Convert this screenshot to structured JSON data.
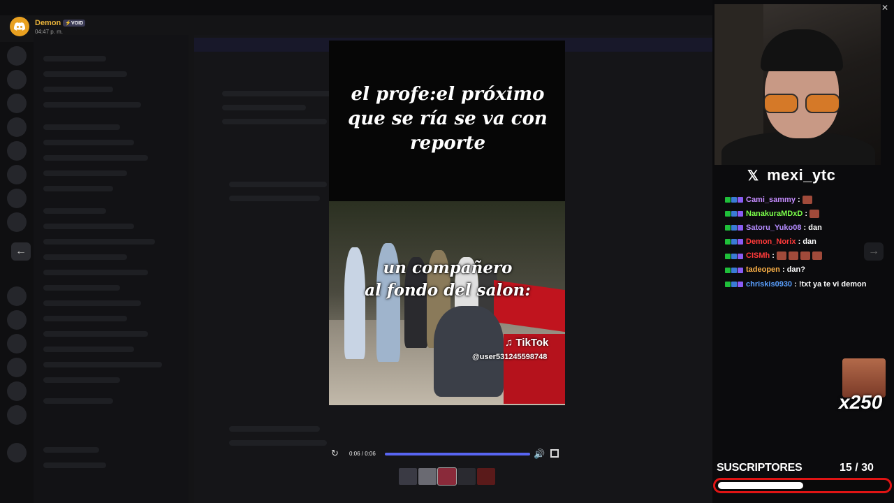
{
  "notification": {
    "icon": "discord-logo-icon",
    "user": "Demon",
    "badge": "⚡VOID",
    "time": "04:47 p. m."
  },
  "video": {
    "caption_top": "el profe:el próximo que se ría se va  con reporte",
    "caption_mid_line1": "un compañero",
    "caption_mid_line2": "al fondo del salon:",
    "watermark_brand": "TikTok",
    "watermark_user": "@user531245598748",
    "time": "0:06 / 0:06",
    "progress": 1.0
  },
  "navigation": {
    "prev_icon": "arrow-left-icon",
    "next_icon": "arrow-right-icon",
    "close_icon": "close-icon"
  },
  "stream": {
    "handle": "mexi_ytc",
    "chat": [
      {
        "user": "Cami_sammy",
        "color": "#c58cff",
        "message": "",
        "emotes": 1
      },
      {
        "user": "NanakuraMDxD",
        "color": "#7bff4a",
        "message": "",
        "emotes": 1
      },
      {
        "user": "Satoru_Yuko08",
        "color": "#b58cff",
        "message": "dan",
        "emotes": 0
      },
      {
        "user": "Demon_Norix",
        "color": "#ff3a3a",
        "message": "dan",
        "emotes": 0
      },
      {
        "user": "CISMh",
        "color": "#ff3a3a",
        "message": "",
        "emotes": 4
      },
      {
        "user": "tadeopen",
        "color": "#ffb347",
        "message": "dan?",
        "emotes": 0
      },
      {
        "user": "chriskis0930",
        "color": "#5aa0ff",
        "message": "!txt ya te vi demon",
        "emotes": 0
      }
    ],
    "combo": "x250",
    "subs_label": "SUSCRIPTORES",
    "subs_count": "15  / 30",
    "subs_progress": 0.5
  }
}
